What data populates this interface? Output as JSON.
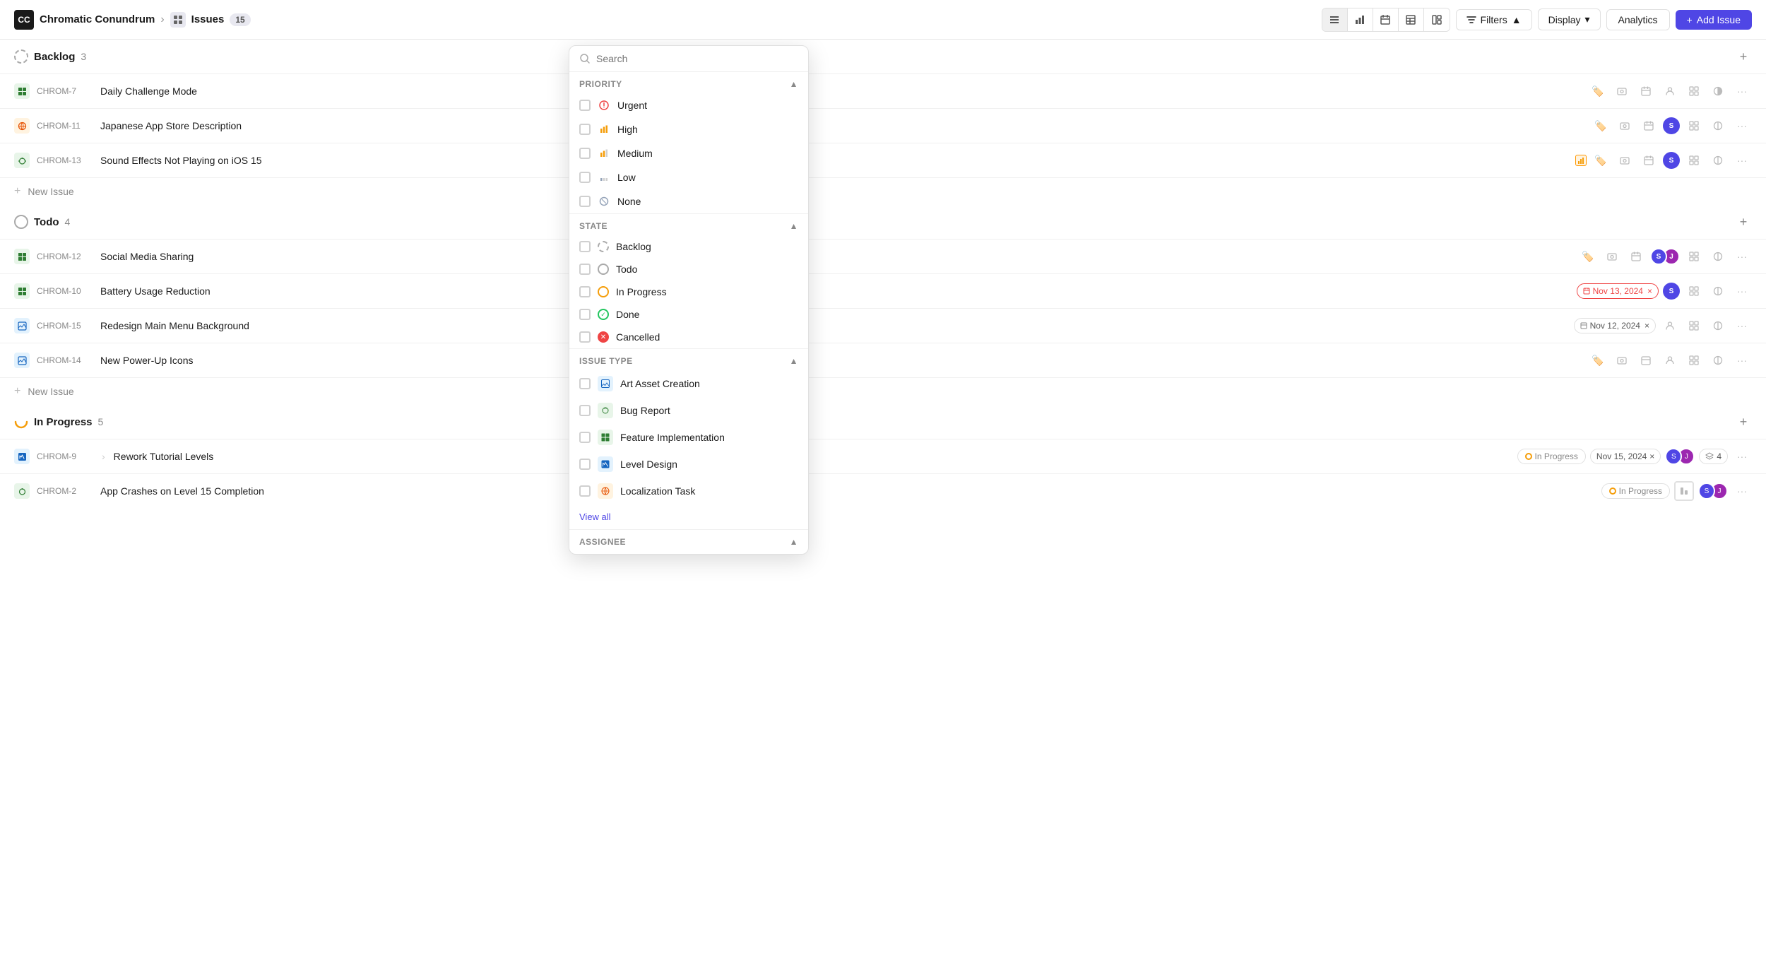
{
  "header": {
    "logo_text": "CC",
    "project_name": "Chromatic Conundrum",
    "chevron": "›",
    "issues_label": "Issues",
    "issues_count": "15",
    "view_buttons": [
      "list",
      "chart-bar",
      "calendar",
      "table",
      "layout"
    ],
    "filters_label": "Filters",
    "filters_chevron": "▲",
    "display_label": "Display",
    "display_chevron": "▾",
    "analytics_label": "Analytics",
    "add_issue_label": "Add  Issue",
    "add_icon": "+"
  },
  "groups": [
    {
      "id": "backlog",
      "title": "Backlog",
      "count": "3",
      "issues": [
        {
          "id": "CHROM-7",
          "title": "Daily Challenge Mode",
          "type": "feature"
        },
        {
          "id": "CHROM-11",
          "title": "Japanese App Store Description",
          "type": "localization"
        },
        {
          "id": "CHROM-13",
          "title": "Sound Effects Not Playing on iOS 15",
          "type": "bug"
        }
      ]
    },
    {
      "id": "todo",
      "title": "Todo",
      "count": "4",
      "issues": [
        {
          "id": "CHROM-12",
          "title": "Social Media Sharing",
          "type": "feature"
        },
        {
          "id": "CHROM-10",
          "title": "Battery Usage Reduction",
          "type": "feature"
        },
        {
          "id": "CHROM-15",
          "title": "Redesign Main Menu Background",
          "type": "art"
        },
        {
          "id": "CHROM-14",
          "title": "New Power-Up Icons",
          "type": "art"
        }
      ]
    },
    {
      "id": "in_progress",
      "title": "In Progress",
      "count": "5",
      "issues": [
        {
          "id": "CHROM-9",
          "title": "Rework Tutorial Levels",
          "type": "level",
          "has_sub": true,
          "status": "In Progress",
          "date": "Nov 15, 2024",
          "layers": "4"
        },
        {
          "id": "CHROM-2",
          "title": "App Crashes on Level 15 Completion",
          "type": "bug",
          "status": "In Progress"
        }
      ]
    }
  ],
  "new_issue_label": "New Issue",
  "filter_panel": {
    "search_placeholder": "Search",
    "priority_label": "Priority",
    "priority_options": [
      {
        "label": "Urgent",
        "icon": "urgent"
      },
      {
        "label": "High",
        "icon": "high"
      },
      {
        "label": "Medium",
        "icon": "medium"
      },
      {
        "label": "Low",
        "icon": "low"
      },
      {
        "label": "None",
        "icon": "none"
      }
    ],
    "state_label": "State",
    "state_options": [
      {
        "label": "Backlog",
        "type": "backlog"
      },
      {
        "label": "Todo",
        "type": "todo"
      },
      {
        "label": "In Progress",
        "type": "inprogress"
      },
      {
        "label": "Done",
        "type": "done"
      },
      {
        "label": "Cancelled",
        "type": "cancelled"
      }
    ],
    "issue_type_label": "Issue Type",
    "issue_type_options": [
      {
        "label": "Art Asset Creation",
        "type": "art"
      },
      {
        "label": "Bug Report",
        "type": "bug"
      },
      {
        "label": "Feature Implementation",
        "type": "feature"
      },
      {
        "label": "Level Design",
        "type": "level"
      },
      {
        "label": "Localization Task",
        "type": "localization"
      }
    ],
    "view_all_label": "View all",
    "assignee_label": "Assignee"
  },
  "actions": {
    "tag": "🏷",
    "camera": "📷",
    "calendar": "📅",
    "person": "👤",
    "grid": "⊞",
    "contrast": "◑",
    "more": "···"
  }
}
